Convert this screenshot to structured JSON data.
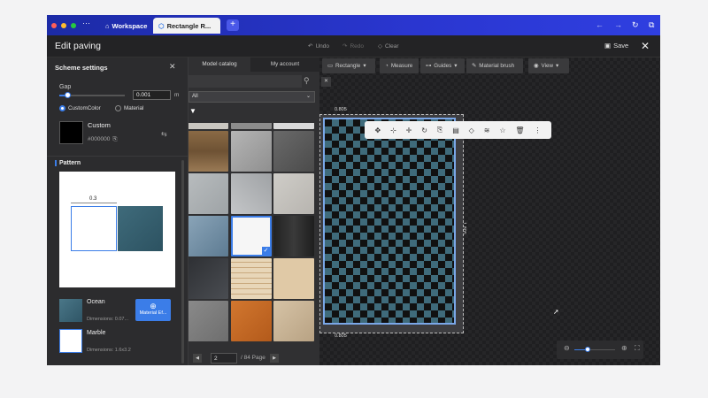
{
  "titlebar": {
    "tabs": [
      {
        "label": "Workspace",
        "icon": "home-icon"
      },
      {
        "label": "Rectangle R...",
        "icon": "cube-icon"
      }
    ],
    "new_tab": "+"
  },
  "header": {
    "title": "Edit paving",
    "undo": "Undo",
    "redo": "Redo",
    "clear": "Clear",
    "save": "Save"
  },
  "scheme": {
    "title": "Scheme settings",
    "gap_label": "Gap",
    "gap_value": "0.001",
    "gap_unit": "m",
    "radio_custom": "CustomColor",
    "radio_material": "Material",
    "color_name": "Custom",
    "color_hex": "#000000"
  },
  "pattern": {
    "title": "Pattern",
    "dimension_label": "0.3"
  },
  "materials": [
    {
      "name": "Ocean",
      "dims": "Dimensions: 0.07...",
      "button": "Material Ef..."
    },
    {
      "name": "Marble",
      "dims": "Dimensions: 1.6x3.2"
    }
  ],
  "catalog": {
    "tab_model": "Model catalog",
    "tab_account": "My account",
    "filter_value": "All",
    "page_value": "2",
    "page_total": "/ 84 Page"
  },
  "toolbar": {
    "rectangle": "Rectangle",
    "measure": "Measure",
    "guides": "Guides",
    "brush": "Material brush",
    "view": "View"
  },
  "canvas": {
    "dim_top": "0.805",
    "dim_bottom": "0.805",
    "dim_side": "1.805"
  },
  "colors": {
    "accent": "#3b7de8",
    "tile_blue": "#3f6b7b",
    "tile_black": "#111111"
  }
}
